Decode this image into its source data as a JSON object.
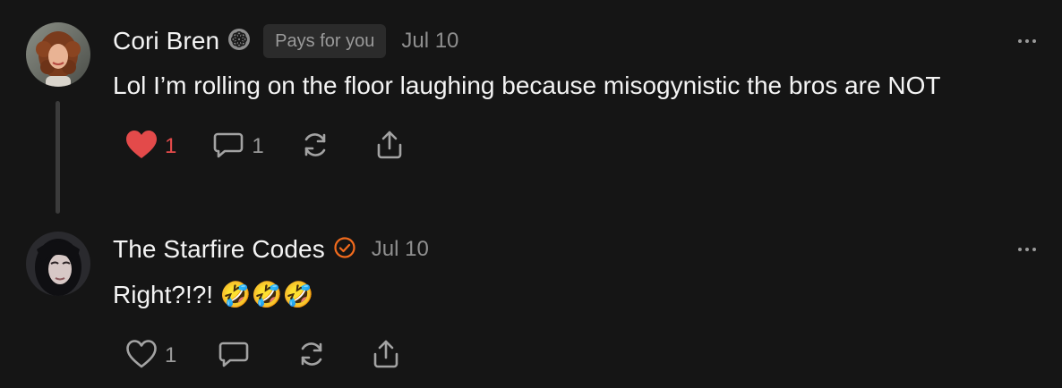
{
  "comments": [
    {
      "author": "Cori Bren",
      "badge_icon": "subscriber-flower-icon",
      "pays_badge": "Pays for you",
      "date": "Jul 10",
      "text": "Lol I’m rolling on the floor laughing because misogynistic the bros are NOT",
      "likes": "1",
      "liked": true,
      "replies": "1",
      "like_color": "#e34a4a"
    },
    {
      "author": "The Starfire Codes",
      "badge_icon": "verified-check-icon",
      "badge_color": "#f26b1d",
      "date": "Jul 10",
      "text": "Right?!?! 🤣🤣🤣",
      "likes": "1",
      "liked": false
    }
  ]
}
